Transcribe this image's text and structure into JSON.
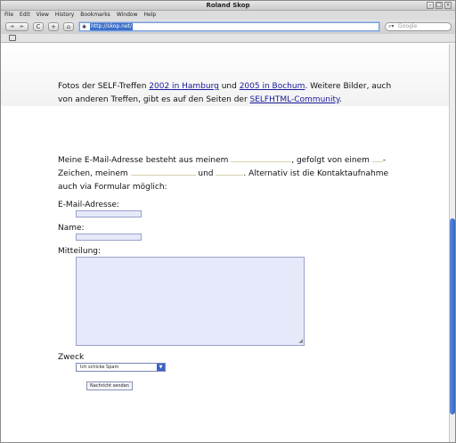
{
  "window": {
    "title": "Roland Skop",
    "buttons": [
      "–",
      "□",
      "×"
    ]
  },
  "menu": [
    "File",
    "Edit",
    "View",
    "History",
    "Bookmarks",
    "Window",
    "Help"
  ],
  "navbar": {
    "back": "◄",
    "forward": "►",
    "reload": "C",
    "add": "+",
    "home": "⌂",
    "url": "http://skop.net/",
    "search_placeholder": "Google"
  },
  "content": {
    "fotos": {
      "prefix": "Fotos der SELF-Treffen ",
      "link1": "2002 in Hamburg",
      "mid": " und ",
      "link2": "2005 in Bochum",
      "suffix1": ". Weitere Bilder, auch von anderen Treffen, gibt es auf den Seiten der ",
      "link3": "SELFHTML-Community",
      "suffix2": "."
    },
    "email": {
      "t1": "Meine E-Mail-Adresse besteht aus meinem ",
      "t2": ", gefolgt von einem ",
      "t3": "-Zeichen, meinem ",
      "t4": " und ",
      "t5": ". Alternativ ist die Kontaktaufnahme auch via Formular möglich:"
    },
    "form": {
      "email_label": "E-Mail-Adresse:",
      "name_label": "Name:",
      "message_label": "Mitteilung:",
      "purpose_label": "Zweck",
      "purpose_selected": "Ich schicke Spam",
      "submit_label": "Nachricht senden"
    }
  }
}
